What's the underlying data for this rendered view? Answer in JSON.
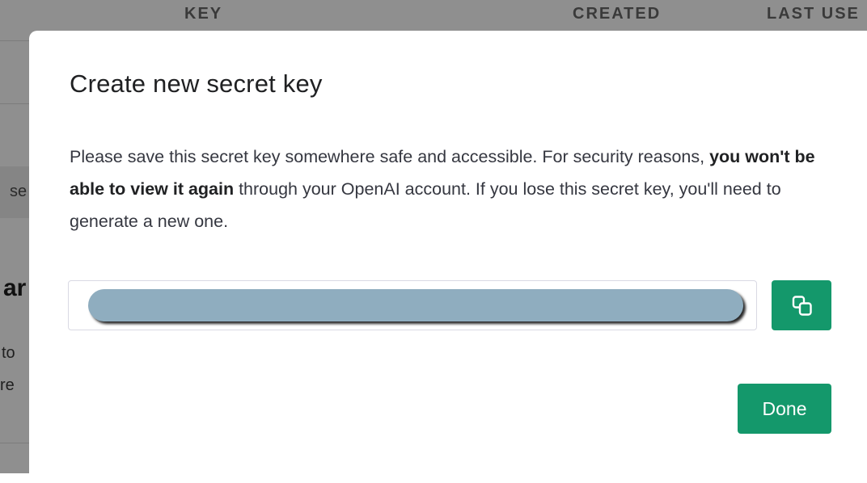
{
  "background": {
    "table_headers": [
      "KEY",
      "CREATED",
      "LAST USE"
    ],
    "fragments": {
      "se": "se",
      "ar": "ar",
      "to": "to",
      "re": "re"
    }
  },
  "modal": {
    "title": "Create new secret key",
    "body": {
      "part1": "Please save this secret key somewhere safe and accessible. For security reasons, ",
      "emphasis": "you won't be able to view it again",
      "part2": " through your OpenAI account. If you lose this secret key, you'll need to generate a new one."
    },
    "key_field": {
      "value_redacted": true
    },
    "copy_button": {
      "icon": "copy-icon"
    },
    "done_label": "Done"
  },
  "colors": {
    "accent": "#14986b",
    "redaction": "#8fadbf",
    "overlay": "#8f8f8f"
  }
}
